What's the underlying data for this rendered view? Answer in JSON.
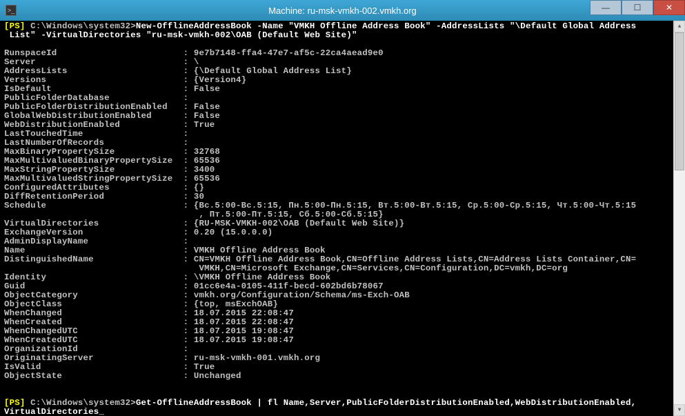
{
  "window": {
    "title": "Machine: ru-msk-vmkh-002.vmkh.org"
  },
  "prompt1": {
    "ps": "[PS]",
    "path": " C:\\Windows\\system32>",
    "cmd": "New-OfflineAddressBook -Name \"VMKH Offline Address Book\" -AddressLists \"\\Default Global Address\n List\" -VirtualDirectories \"ru-msk-vmkh-002\\OAB (Default Web Site)\""
  },
  "output": {
    "rows": [
      {
        "k": "RunspaceId",
        "v": "9e7b7148-ffa4-47e7-af5c-22ca4aead9e0"
      },
      {
        "k": "Server",
        "v": "\\"
      },
      {
        "k": "AddressLists",
        "v": "{\\Default Global Address List}"
      },
      {
        "k": "Versions",
        "v": "{Version4}"
      },
      {
        "k": "IsDefault",
        "v": "False"
      },
      {
        "k": "PublicFolderDatabase",
        "v": ""
      },
      {
        "k": "PublicFolderDistributionEnabled",
        "v": "False"
      },
      {
        "k": "GlobalWebDistributionEnabled",
        "v": "False"
      },
      {
        "k": "WebDistributionEnabled",
        "v": "True"
      },
      {
        "k": "LastTouchedTime",
        "v": ""
      },
      {
        "k": "LastNumberOfRecords",
        "v": ""
      },
      {
        "k": "MaxBinaryPropertySize",
        "v": "32768"
      },
      {
        "k": "MaxMultivaluedBinaryPropertySize",
        "v": "65536"
      },
      {
        "k": "MaxStringPropertySize",
        "v": "3400"
      },
      {
        "k": "MaxMultivaluedStringPropertySize",
        "v": "65536"
      },
      {
        "k": "ConfiguredAttributes",
        "v": "{}"
      },
      {
        "k": "DiffRetentionPeriod",
        "v": "30"
      },
      {
        "k": "Schedule",
        "v": "{Вс.5:00-Вс.5:15, Пн.5:00-Пн.5:15, Вт.5:00-Вт.5:15, Ср.5:00-Ср.5:15, Чт.5:00-Чт.5:15\n                                     , Пт.5:00-Пт.5:15, Сб.5:00-Сб.5:15}"
      },
      {
        "k": "VirtualDirectories",
        "v": "{RU-MSK-VMKH-002\\OAB (Default Web Site)}"
      },
      {
        "k": "ExchangeVersion",
        "v": "0.20 (15.0.0.0)"
      },
      {
        "k": "AdminDisplayName",
        "v": ""
      },
      {
        "k": "Name",
        "v": "VMKH Offline Address Book"
      },
      {
        "k": "DistinguishedName",
        "v": "CN=VMKH Offline Address Book,CN=Offline Address Lists,CN=Address Lists Container,CN=\n                                     VMKH,CN=Microsoft Exchange,CN=Services,CN=Configuration,DC=vmkh,DC=org"
      },
      {
        "k": "Identity",
        "v": "\\VMKH Offline Address Book"
      },
      {
        "k": "Guid",
        "v": "01cc6e4a-0105-411f-becd-602bd6b78067"
      },
      {
        "k": "ObjectCategory",
        "v": "vmkh.org/Configuration/Schema/ms-Exch-OAB"
      },
      {
        "k": "ObjectClass",
        "v": "{top, msExchOAB}"
      },
      {
        "k": "WhenChanged",
        "v": "18.07.2015 22:08:47"
      },
      {
        "k": "WhenCreated",
        "v": "18.07.2015 22:08:47"
      },
      {
        "k": "WhenChangedUTC",
        "v": "18.07.2015 19:08:47"
      },
      {
        "k": "WhenCreatedUTC",
        "v": "18.07.2015 19:08:47"
      },
      {
        "k": "OrganizationId",
        "v": ""
      },
      {
        "k": "OriginatingServer",
        "v": "ru-msk-vmkh-001.vmkh.org"
      },
      {
        "k": "IsValid",
        "v": "True"
      },
      {
        "k": "ObjectState",
        "v": "Unchanged"
      }
    ]
  },
  "prompt2": {
    "ps": "[PS]",
    "path": " C:\\Windows\\system32>",
    "cmd": "Get-OfflineAddressBook | fl Name,Server,PublicFolderDistributionEnabled,WebDistributionEnabled,\nVirtualDirectories_"
  }
}
